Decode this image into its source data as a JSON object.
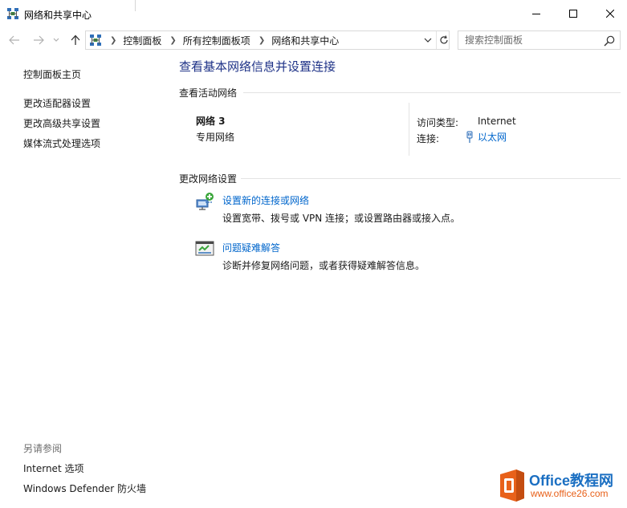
{
  "window": {
    "title": "网络和共享中心",
    "icon": "network-icon"
  },
  "address": {
    "crumbs": [
      "控制面板",
      "所有控制面板项",
      "网络和共享中心"
    ]
  },
  "search": {
    "placeholder": "搜索控制面板"
  },
  "sidebar": {
    "home": "控制面板主页",
    "items": [
      {
        "label": "更改适配器设置"
      },
      {
        "label": "更改高级共享设置"
      },
      {
        "label": "媒体流式处理选项"
      }
    ],
    "see_also_title": "另请参阅",
    "see_also": [
      {
        "label": "Internet 选项"
      },
      {
        "label": "Windows Defender 防火墙"
      }
    ]
  },
  "main": {
    "title": "查看基本网络信息并设置连接",
    "active_section": "查看活动网络",
    "network": {
      "name": "网络 3",
      "type": "专用网络",
      "access_label": "访问类型:",
      "access_value": "Internet",
      "connection_label": "连接:",
      "connection_value": "以太网"
    },
    "change_section": "更改网络设置",
    "tasks": [
      {
        "label": "设置新的连接或网络",
        "desc": "设置宽带、拨号或 VPN 连接；或设置路由器或接入点。",
        "icon": "new-connection-icon"
      },
      {
        "label": "问题疑难解答",
        "desc": "诊断并修复网络问题，或者获得疑难解答信息。",
        "icon": "troubleshoot-icon"
      }
    ]
  },
  "watermark": {
    "line1": "Office教程网",
    "line2": "www.office26.com"
  },
  "colors": {
    "title_blue": "#1e3287",
    "link_blue": "#0066cc",
    "logo_orange": "#e8611a",
    "logo_blue": "#1b6fc2"
  }
}
